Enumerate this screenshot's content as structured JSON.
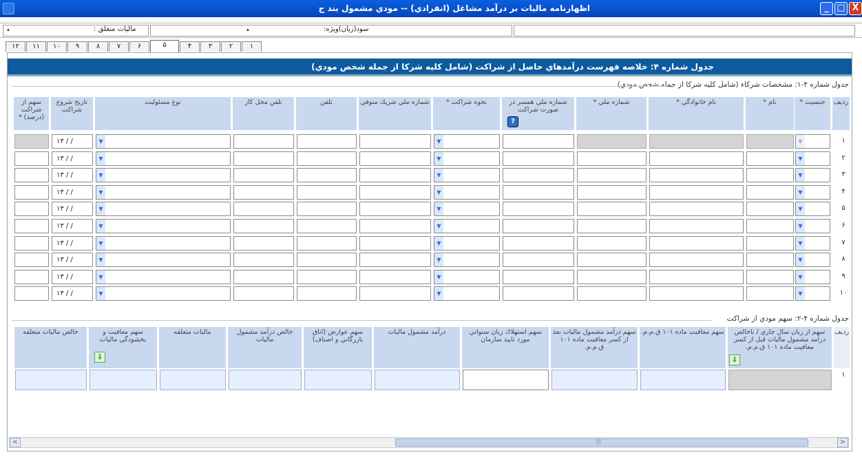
{
  "window": {
    "title": "اظهارنامه ماليات بر درآمد مشاغل (انفرادي) -- مودي مشمول بند ج",
    "minimize": "_",
    "maximize": "□",
    "close": "X"
  },
  "infobar": {
    "tax_label": "ماليات متعلق :",
    "tax_value": "•",
    "profit_label": "سود(زيان)ويژه:",
    "profit_value": "•"
  },
  "tabs": [
    "۱۲",
    "۱۱",
    "۱۰",
    "۹",
    "۸",
    "۷",
    "۶",
    "۵",
    "۴",
    "۳",
    "۲",
    "۱"
  ],
  "active_tab": "۵",
  "header": {
    "title": "جدول شماره ۴: خلاصه فهرست درآمدهاي حاصل از شراكت (شامل كليه شركا از جمله شخص مودي)"
  },
  "table1": {
    "title": "جدول شماره ۴-۱: مشخصات شركاء (شامل كليه شركا از جمله شخص مودي)",
    "columns": [
      "رديف",
      "جنسيت *",
      "نام *",
      "نام خانوادگي *",
      "شماره ملي *",
      "شماره ملي همسر در صورت شراكت",
      "نحوه شراكت *",
      "شماره ملي شريك متوفي",
      "تلفن",
      "تلفن محل كار",
      "نوع مسئوليت",
      "تاريخ شروع شراكت",
      "سهم از شراكت (درصد) *"
    ],
    "date_placeholder": "۱۳ / /",
    "rows": [
      "۱",
      "۲",
      "۳",
      "۴",
      "۵",
      "۶",
      "۷",
      "۸",
      "۹",
      "۱۰"
    ],
    "help_icon": "?"
  },
  "table2": {
    "title": "جدول شماره ۴-۲: سهم مودي از شراكت",
    "columns": [
      "رديف",
      "سهم از زيان سال جاري / ناخالص درآمد مشمول ماليات قبل از كسر معافيت ماده ۱۰۱ ق.م.م.",
      "سهم معافيت ماده ۱۰۱ ق.م.م.",
      "سهم درآمد مشمول ماليات بعد از كسر معافيت ماده ۱۰۱ ق.م.م.",
      "سهم استهلاك زيان سنواتي مورد تاييد سازمان",
      "درآمد مشمول ماليات",
      "سهم عوارض (اتاق بازرگاني و اصناف)",
      "خالص درآمد مشمول ماليات",
      "ماليات متعلقه",
      "سهم معافيت و بخشودگي ماليات",
      "خالص ماليات متعلقه"
    ],
    "rows": [
      "۱"
    ]
  },
  "scrollbar": {
    "left_arrow": "<",
    "right_arrow": ">",
    "grip": "|||"
  },
  "colors": {
    "titlebar": "#0646b8",
    "header_band": "#0e5a9e",
    "column_header": "#c8d8ee",
    "disabled_cell": "#d4d4d4"
  }
}
